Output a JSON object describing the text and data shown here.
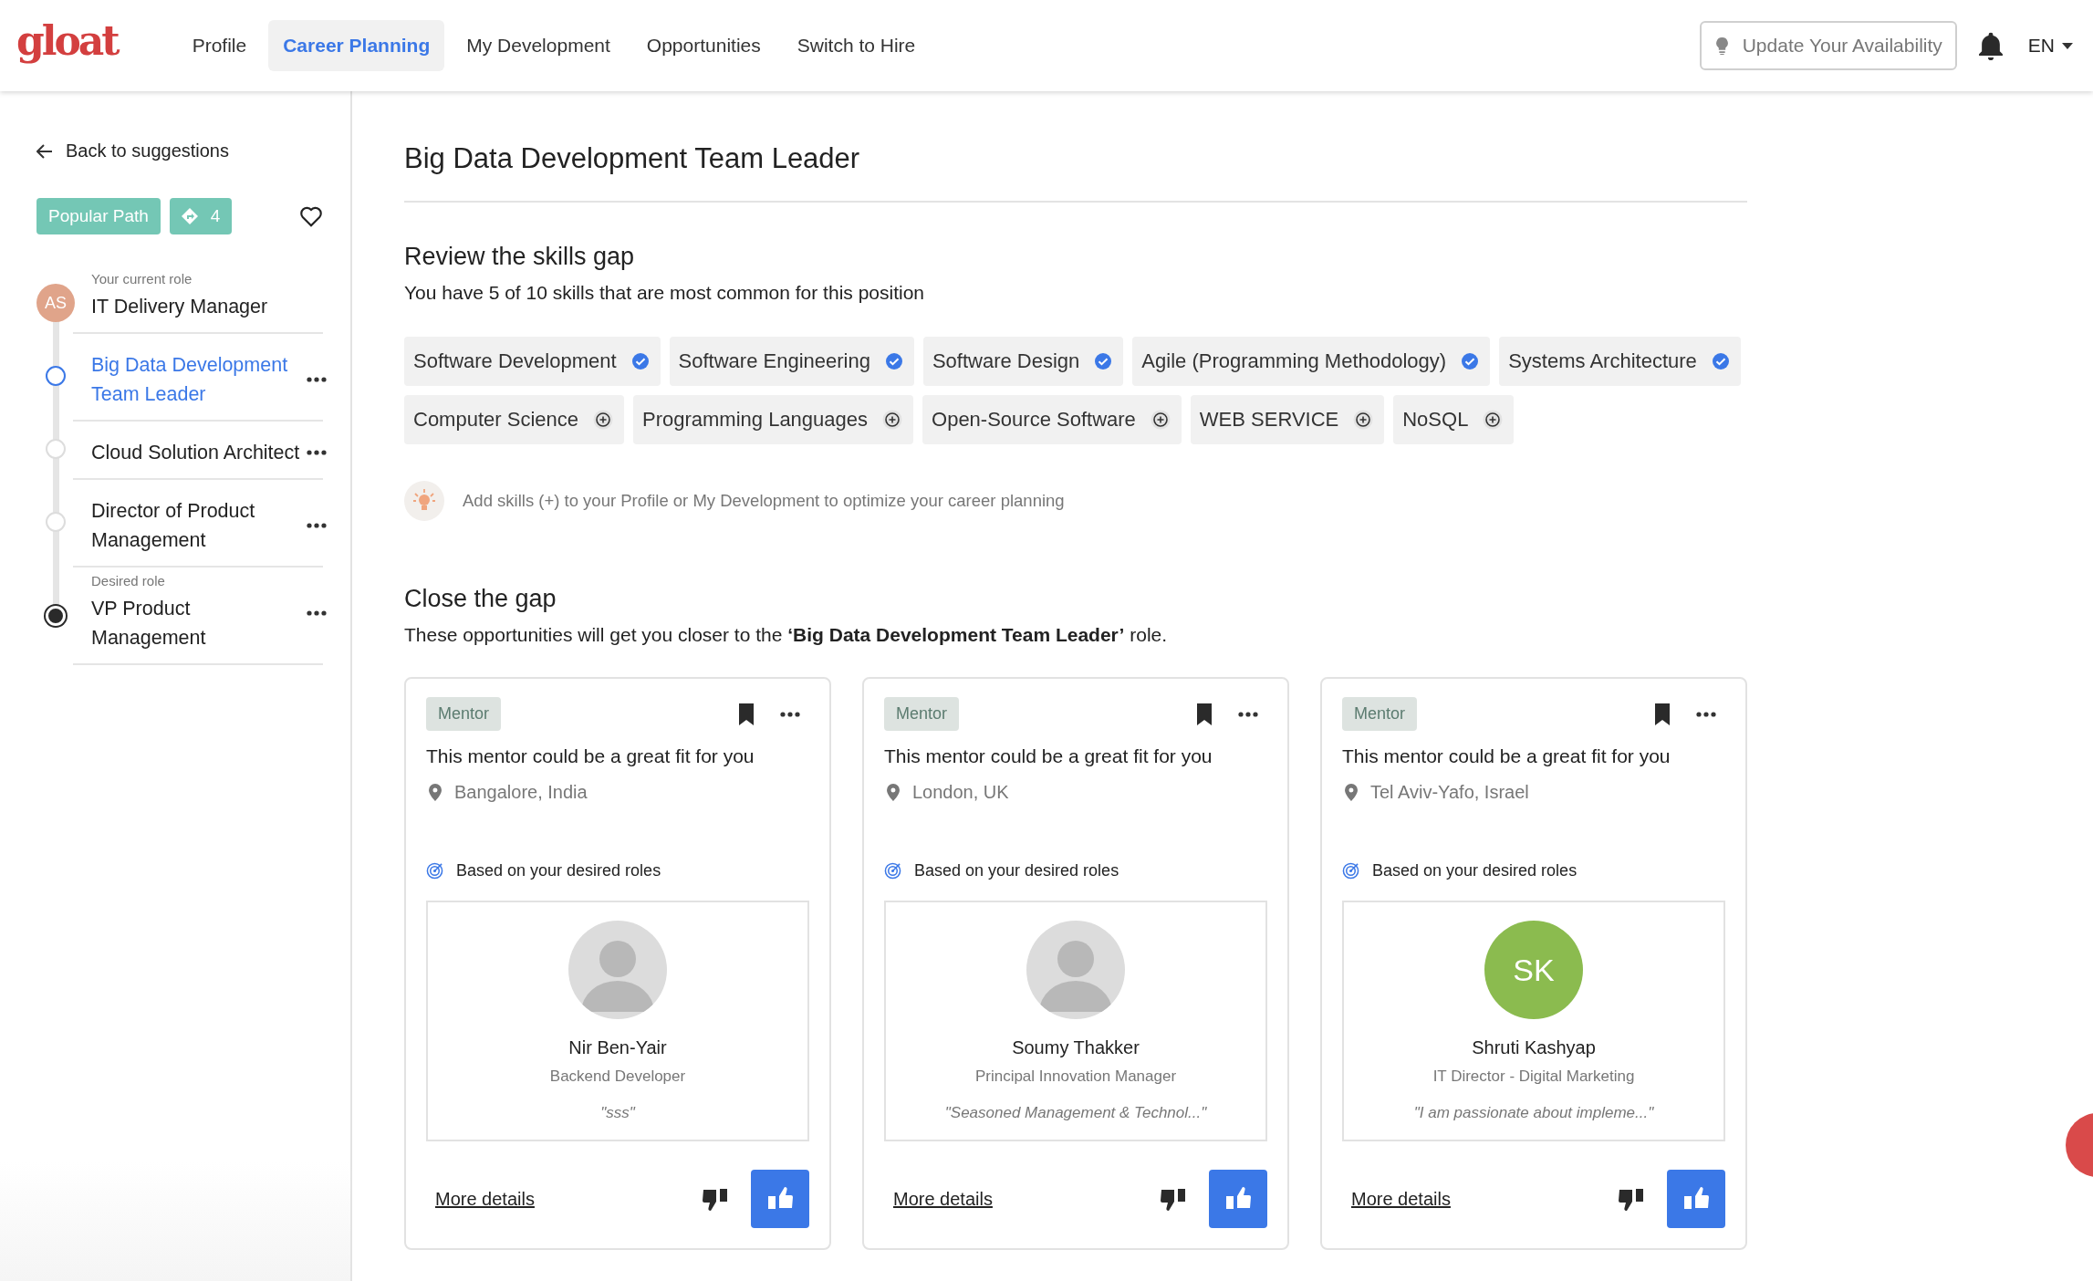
{
  "header": {
    "logo": "gloat",
    "nav": [
      {
        "label": "Profile",
        "selected": false
      },
      {
        "label": "Career Planning",
        "selected": true
      },
      {
        "label": "My Development",
        "selected": false
      },
      {
        "label": "Opportunities",
        "selected": false
      },
      {
        "label": "Switch to Hire",
        "selected": false
      }
    ],
    "availability_button": "Update Your Availability",
    "language": "EN"
  },
  "sidebar": {
    "back_link": "Back to suggestions",
    "popular_tag": "Popular Path",
    "steps_count": "4",
    "favorite": false,
    "path": [
      {
        "kind": "current",
        "caption": "Your current role",
        "initials": "AS",
        "title": "IT Delivery Manager",
        "selected": false
      },
      {
        "kind": "step",
        "title": "Big Data Development Team Leader",
        "selected": true
      },
      {
        "kind": "step",
        "title": "Cloud Solution Architect",
        "selected": false
      },
      {
        "kind": "step",
        "title": "Director of Product Management",
        "selected": false
      },
      {
        "kind": "desired",
        "caption": "Desired role",
        "title": "VP Product Management",
        "selected": false
      }
    ]
  },
  "main": {
    "title": "Big Data Development Team Leader",
    "skills_gap": {
      "heading": "Review the skills gap",
      "summary": "You have 5 of 10 skills that are most common for this position",
      "skills": [
        {
          "name": "Software Development",
          "has_skill": true
        },
        {
          "name": "Software Engineering",
          "has_skill": true
        },
        {
          "name": "Software Design",
          "has_skill": true
        },
        {
          "name": "Agile (Programming Methodology)",
          "has_skill": true
        },
        {
          "name": "Systems Architecture",
          "has_skill": true
        },
        {
          "name": "Computer Science",
          "has_skill": false
        },
        {
          "name": "Programming Languages",
          "has_skill": false
        },
        {
          "name": "Open-Source Software",
          "has_skill": false
        },
        {
          "name": "WEB SERVICE",
          "has_skill": false
        },
        {
          "name": "NoSQL",
          "has_skill": false
        }
      ],
      "tip": "Add skills (+) to your Profile or My Development to optimize your career planning"
    },
    "close_gap": {
      "heading": "Close the gap",
      "summary": "These opportunities will get you closer to the **‘Big Data Development Team Leader’** role.",
      "cards": [
        {
          "tag": "Mentor",
          "headline": "This mentor could be a great fit for you",
          "location": "Bangalore, India",
          "reason": "Based on your desired roles",
          "kind": "photo",
          "name": "Nir Ben-Yair",
          "role": "Backend Developer",
          "quote": "\"sss\"",
          "link": "More details"
        },
        {
          "tag": "Mentor",
          "headline": "This mentor could be a great fit for you",
          "location": "London, UK",
          "reason": "Based on your desired roles",
          "kind": "photo",
          "name": "Soumy Thakker",
          "role": "Principal Innovation Manager",
          "quote": "\"Seasoned Management & Technol...\"",
          "link": "More details"
        },
        {
          "tag": "Mentor",
          "headline": "This mentor could be a great fit for you",
          "location": "Tel Aviv-Yafo, Israel",
          "reason": "Based on your desired roles",
          "kind": "initials",
          "initials": "SK",
          "color": "#8bbb4f",
          "name": "Shruti Kashyap",
          "role": "IT Director - Digital Marketing",
          "quote": "\"I am passionate about impleme...\"",
          "link": "More details"
        }
      ]
    }
  }
}
